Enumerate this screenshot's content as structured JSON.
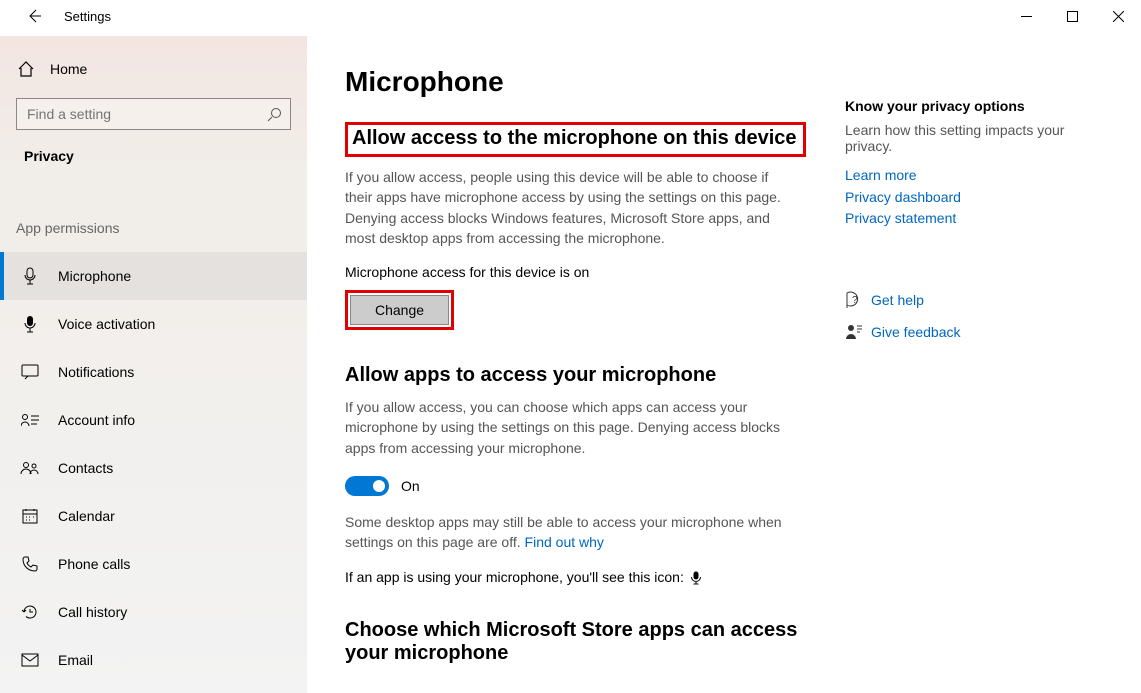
{
  "titlebar": {
    "app_title": "Settings"
  },
  "sidebar": {
    "home_label": "Home",
    "search_placeholder": "Find a setting",
    "section_label": "Privacy",
    "group_label": "App permissions",
    "items": [
      {
        "label": "Microphone"
      },
      {
        "label": "Voice activation"
      },
      {
        "label": "Notifications"
      },
      {
        "label": "Account info"
      },
      {
        "label": "Contacts"
      },
      {
        "label": "Calendar"
      },
      {
        "label": "Phone calls"
      },
      {
        "label": "Call history"
      },
      {
        "label": "Email"
      }
    ]
  },
  "main": {
    "page_title": "Microphone",
    "section1": {
      "heading": "Allow access to the microphone on this device",
      "description": "If you allow access, people using this device will be able to choose if their apps have microphone access by using the settings on this page. Denying access blocks Windows features, Microsoft Store apps, and most desktop apps from accessing the microphone.",
      "status": "Microphone access for this device is on",
      "change_button": "Change"
    },
    "section2": {
      "heading": "Allow apps to access your microphone",
      "description": "If you allow access, you can choose which apps can access your microphone by using the settings on this page. Denying access blocks apps from accessing your microphone.",
      "toggle_label": "On",
      "note_pre": "Some desktop apps may still be able to access your microphone when settings on this page are off. ",
      "note_link": "Find out why",
      "usage_line": "If an app is using your microphone, you'll see this icon:"
    },
    "section3": {
      "heading": "Choose which Microsoft Store apps can access your microphone"
    }
  },
  "aside": {
    "title": "Know your privacy options",
    "desc": "Learn how this setting impacts your privacy.",
    "links": [
      "Learn more",
      "Privacy dashboard",
      "Privacy statement"
    ],
    "help": "Get help",
    "feedback": "Give feedback"
  }
}
